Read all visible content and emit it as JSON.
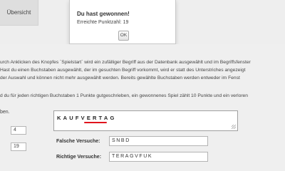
{
  "nav": {
    "overview_tab": "Übersicht"
  },
  "dialog": {
    "title": "Du hast gewonnen!",
    "message": "Erreichte Punktzahl: 19",
    "ok_label": "OK"
  },
  "instructions": {
    "line1": "urch Anklicken des Knopfes `Spielstart` wird ein zufälliger Begriff aus der Datenbank ausgewählt und im Begriffsfenster",
    "line2": "Hast du einen Buchstaben ausgewählt, der im gesuchten Begriff vorkommt, wird er statt des Unterstriches angezeigt",
    "line3": "der Auswahl und können nicht mehr ausgewählt werden. Bereits gewählte Buchstaben werden entweder im Fenst",
    "line4": "d du für jeden richtigen Buchstaben 1 Punkte gutgeschrieben, ein gewonnenes Spiel zählt 10 Punkte und ein verloren"
  },
  "game": {
    "left_label": "ben.",
    "count_top": "4",
    "count_bottom": "19",
    "word": "KAUFVERTAG",
    "wrong_label": "Falsche Versuche:",
    "wrong_value": "SNBD",
    "right_label": "Richtige Versuche:",
    "right_value": "TERAGVFUK"
  },
  "colors": {
    "highlight_underline": "#e0141d"
  }
}
